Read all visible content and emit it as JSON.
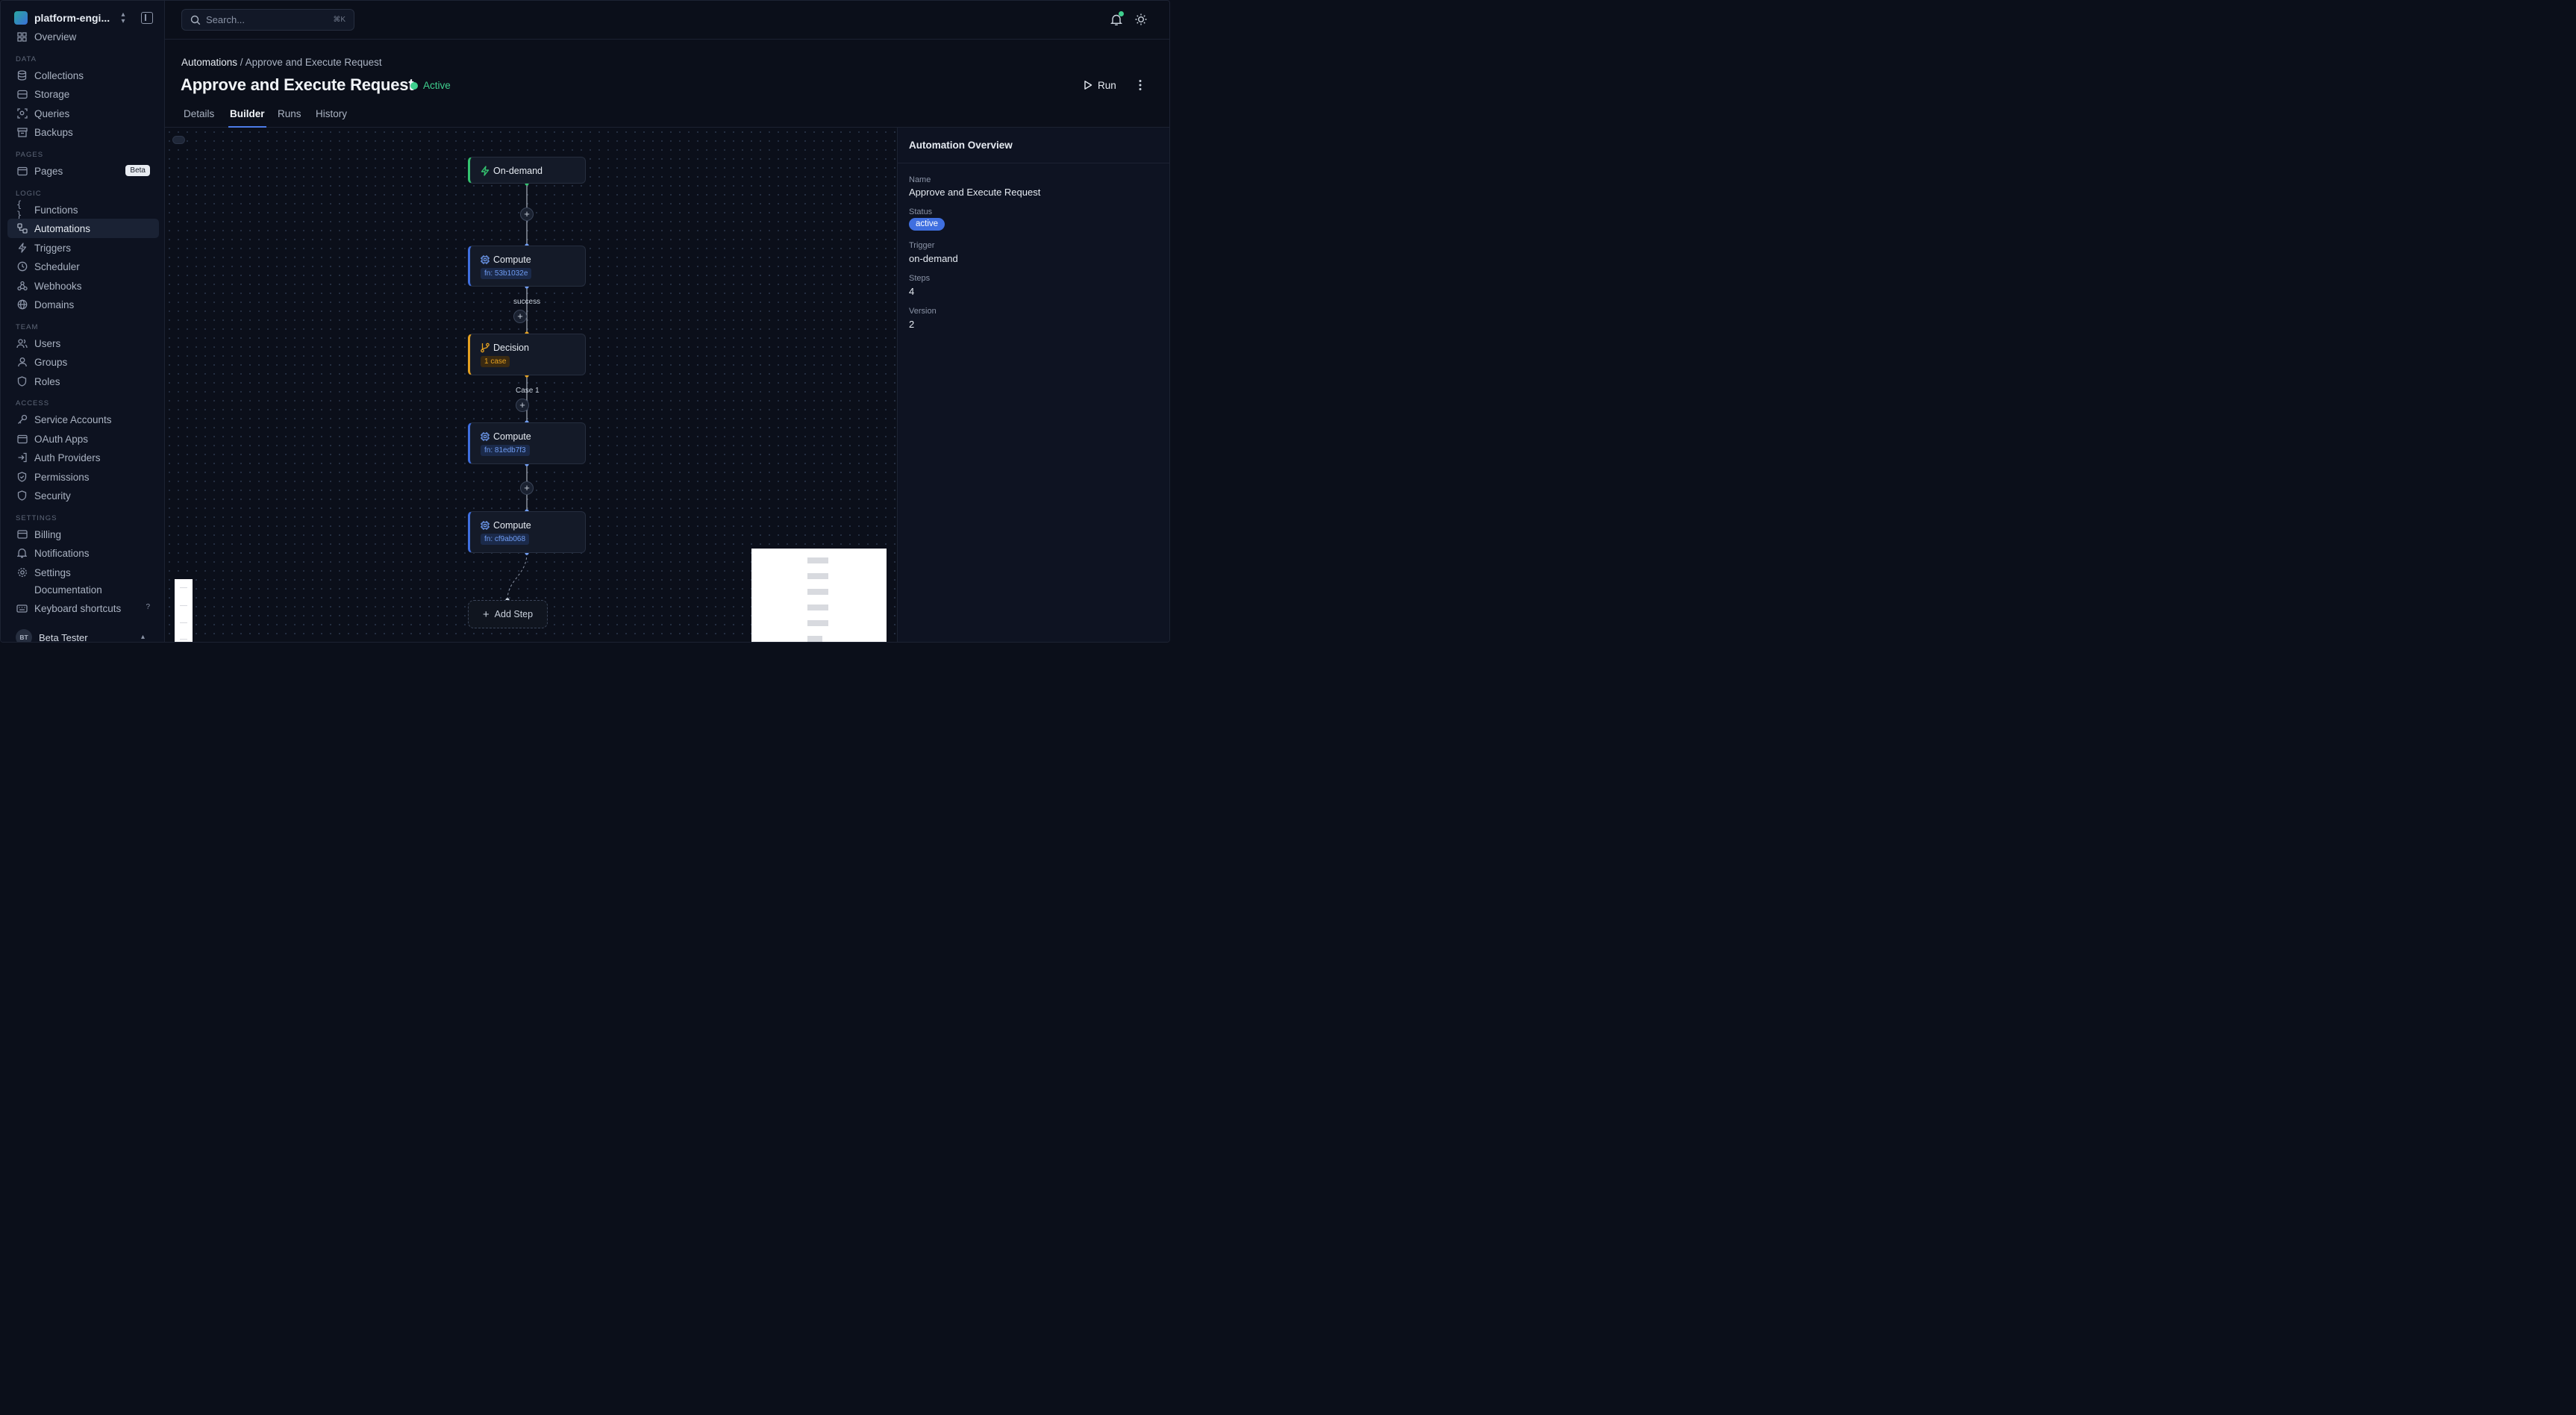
{
  "workspace": {
    "name": "platform-engi..."
  },
  "sidebar": {
    "partial_item": "Overview",
    "sections": {
      "data": "DATA",
      "pages": "PAGES",
      "logic": "LOGIC",
      "team": "TEAM",
      "access": "ACCESS",
      "settings": "SETTINGS"
    },
    "items": {
      "collections": "Collections",
      "storage": "Storage",
      "queries": "Queries",
      "backups": "Backups",
      "pages": "Pages",
      "pages_badge": "Beta",
      "functions": "Functions",
      "automations": "Automations",
      "triggers": "Triggers",
      "scheduler": "Scheduler",
      "webhooks": "Webhooks",
      "domains": "Domains",
      "users": "Users",
      "groups": "Groups",
      "roles": "Roles",
      "service_accounts": "Service Accounts",
      "oauth_apps": "OAuth Apps",
      "auth_providers": "Auth Providers",
      "permissions": "Permissions",
      "security": "Security",
      "billing": "Billing",
      "notifications": "Notifications",
      "settings": "Settings",
      "documentation": "Documentation",
      "keyboard_shortcuts": "Keyboard shortcuts",
      "keyboard_shortcuts_hint": "?"
    },
    "user": {
      "initials": "BT",
      "name": "Beta Tester"
    }
  },
  "search": {
    "placeholder": "Search...",
    "shortcut": "⌘K"
  },
  "breadcrumb": {
    "parent": "Automations",
    "separator": " / ",
    "current": "Approve and Execute Request"
  },
  "page": {
    "title": "Approve and Execute Request",
    "status": "Active",
    "run_label": "Run"
  },
  "tabs": [
    "Details",
    "Builder",
    "Runs",
    "History"
  ],
  "flow": {
    "trigger": {
      "title": "On-demand"
    },
    "step1": {
      "title": "Compute",
      "tag": "fn: 53b1032e"
    },
    "edge1_label": "success",
    "step2": {
      "title": "Decision",
      "tag": "1 case"
    },
    "edge2_label": "Case 1",
    "step3": {
      "title": "Compute",
      "tag": "fn: 81edb7f3"
    },
    "step4": {
      "title": "Compute",
      "tag": "fn: cf9ab068"
    },
    "add_step": "Add Step",
    "plus": "+"
  },
  "panel": {
    "title": "Automation Overview",
    "name_label": "Name",
    "name_value": "Approve and Execute Request",
    "status_label": "Status",
    "status_value": "active",
    "trigger_label": "Trigger",
    "trigger_value": "on-demand",
    "steps_label": "Steps",
    "steps_value": "4",
    "version_label": "Version",
    "version_value": "2"
  },
  "colors": {
    "accent": "#3f6fe0",
    "active_green": "#3fcf8e",
    "decision_amber": "#e4a020"
  }
}
